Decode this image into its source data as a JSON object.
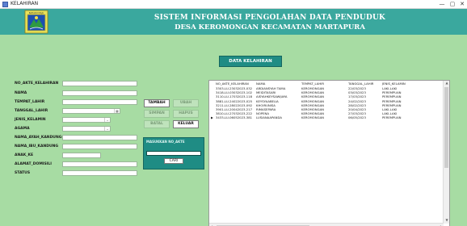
{
  "window": {
    "title": "KELAHIRAN",
    "minimize": "—",
    "maximize": "▢",
    "close": "✕"
  },
  "header": {
    "title_line1": "SISTEM INFORMASI PENGOLAHAN DATA PENDUDUK",
    "title_line2": "DESA KEROMONGAN KECAMATAN MARTAPURA",
    "logo_icon": "regency-emblem-icon",
    "logo_text": "BAHARU MAJU"
  },
  "data_button": "DATA KELAHIRAN",
  "form": {
    "fields": [
      {
        "label": "NO_AKTE_KELAHIRAN",
        "value": ""
      },
      {
        "label": "NAMA",
        "value": ""
      },
      {
        "label": "TEMPAT_LAHIR",
        "value": ""
      },
      {
        "label": "TANGGAL_LAHIR",
        "value": ""
      },
      {
        "label": "JENIS_KELAMIN",
        "value": ""
      },
      {
        "label": "AGAMA",
        "value": ""
      },
      {
        "label": "NAMA_AYAH_KANDUNG",
        "value": ""
      },
      {
        "label": "NAMA_IBU_KANDUNG",
        "value": ""
      },
      {
        "label": "ANAK_KE",
        "value": ""
      },
      {
        "label": "ALAMAT_DOMISILI",
        "value": ""
      },
      {
        "label": "STATUS",
        "value": ""
      }
    ]
  },
  "buttons": {
    "tambah": "TAMBAH",
    "ubah": "UBAH",
    "simpan": "SIMPAN",
    "hapus": "HAPUS",
    "batal": "BATAL",
    "keluar": "KELUAR"
  },
  "search": {
    "label": "MASUKKAN NO_AKTE",
    "value": "",
    "button": "CARI"
  },
  "table": {
    "columns": [
      "NO_AKTE_KELAHIRAN",
      "NAMA",
      "TEMPAT_LAHIR",
      "TANGGAL_LAHIR",
      "JENIS_KELAMIN"
    ],
    "rows": [
      [
        "3303-LU-23032023-032",
        "ARDIANSYAH TAMA",
        "KEROMONGAN",
        "22/03/2023",
        "LAKI-LAKI"
      ],
      [
        "3418-LU-03032023-102",
        "MEIDITASARI",
        "KEROMONGAN",
        "03/03/2023",
        "PEREMPUAN"
      ],
      [
        "3110-LU-17032023-118",
        "AISYAHKEYSAWIJAYA",
        "KEROMONGAN",
        "17/03/2023",
        "PEREMPUAN"
      ],
      [
        "3881-LU-24022023-025",
        "KEYSYAABELIA",
        "KEROMONGAN",
        "24/02/2023",
        "PEREMPUAN"
      ],
      [
        "3211-LU-28022023-092",
        "KHOIRUNISA",
        "KEROMONGAN",
        "28/02/2023",
        "PEREMPUAN"
      ],
      [
        "3901-LU-20042023-217",
        "RIMASEPARA",
        "KEROMONGAN",
        "20/04/2023",
        "LAKI-LAKI"
      ],
      [
        "3810-LU-27032023-222",
        "NOPENA",
        "KEROMONGAN",
        "27/03/2023",
        "LAKI-LAKI"
      ],
      [
        "3433-LU-06052023-381",
        "LUSIANAAPANDA",
        "KEROMONGAN",
        "06/05/2023",
        "PEREMPUAN"
      ]
    ],
    "new_row_marker": "▶"
  },
  "colors": {
    "background": "#a7dca3",
    "header": "#3aa89e",
    "accent": "#1f8c84"
  }
}
